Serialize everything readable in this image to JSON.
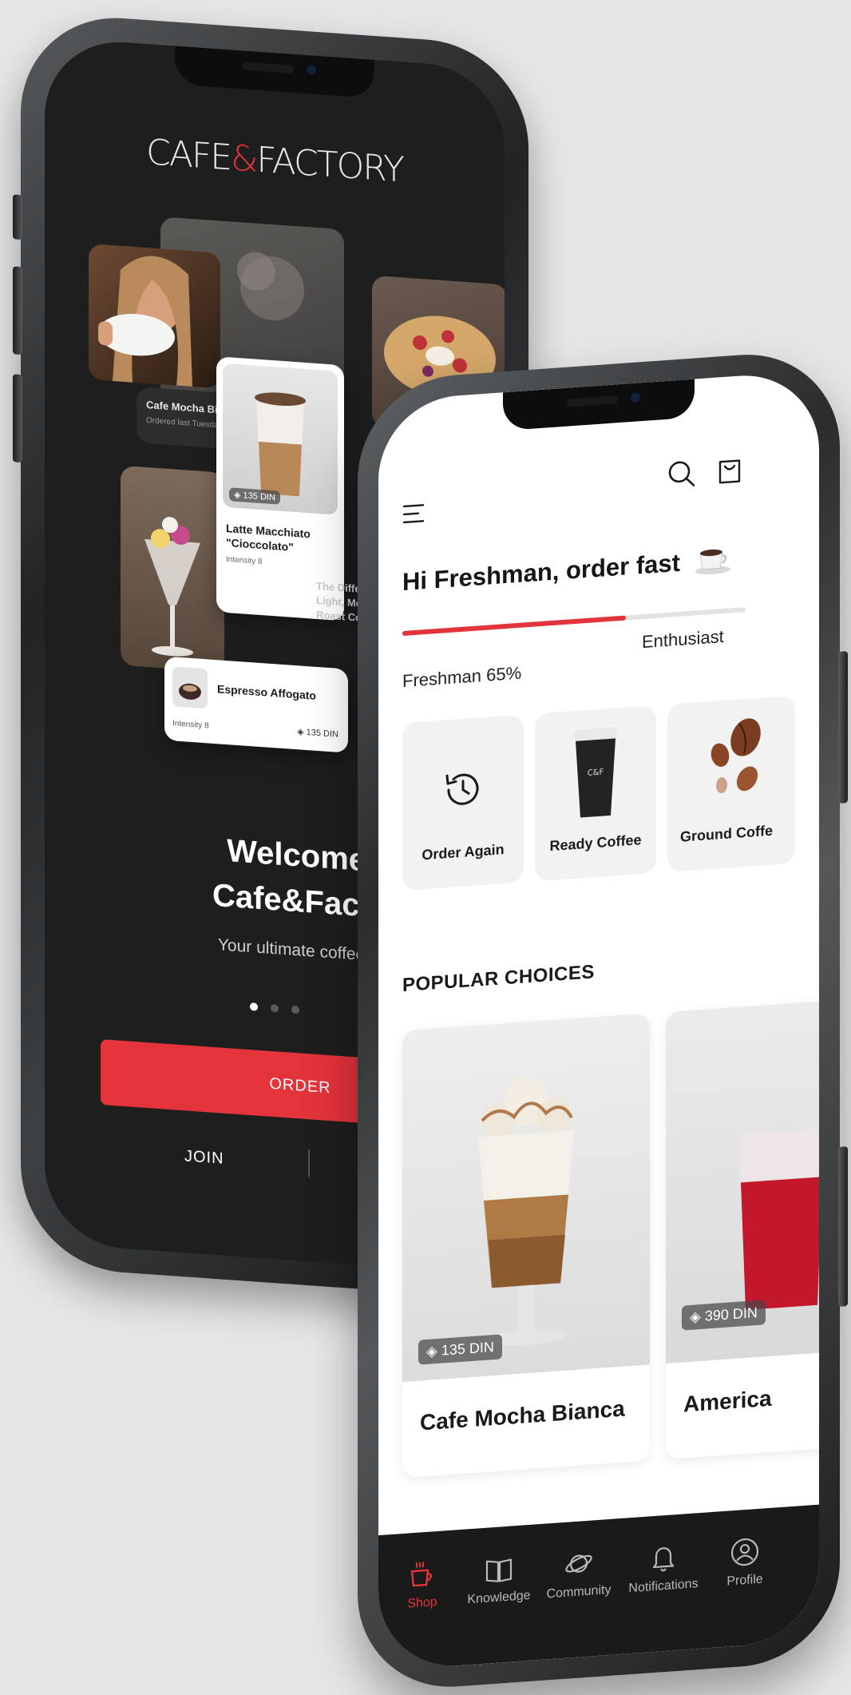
{
  "colors": {
    "accent": "#e3333b",
    "background": "#e6e6e6",
    "dark_screen": "#1e1e1e",
    "tab_bar": "#1a1a1a"
  },
  "onboarding_screen": {
    "logo": {
      "prefix": "CAFE",
      "amp": "&",
      "suffix": "FACTORY"
    },
    "carousel_cards": [
      {
        "title": "Cafe Mocha Bian",
        "subtitle": "Ordered last Tuesday"
      },
      {
        "price": "135 DIN",
        "title": "Latte Macchiato \"Cioccolato\"",
        "subtitle": "Intensity 8"
      },
      {
        "title": "The Difference B Light, Medium, A Roast Coffee"
      },
      {
        "title": "Espresso Affogato",
        "subtitle": "Intensity 8",
        "price": "135 DIN"
      }
    ],
    "welcome_line1": "Welcome to",
    "welcome_line2": "Cafe&Factory",
    "welcome_sub": "Your ultimate coffee destin",
    "page_indicator": {
      "current": 1,
      "total": 3
    },
    "order_button": "ORDER",
    "join_link": "JOIN"
  },
  "shop_screen": {
    "greeting": "Hi Freshman, order fast",
    "greeting_icon": "coffee-cup-icon",
    "progress": {
      "current_level": "Freshman 65%",
      "next_level": "Enthusiast",
      "value": 0.65
    },
    "quick_actions": [
      {
        "label": "Order Again",
        "icon": "history-icon"
      },
      {
        "label": "Ready Coffee",
        "icon": "takeaway-cup-image"
      },
      {
        "label": "Ground Coffe",
        "icon": "coffee-beans-image"
      }
    ],
    "section_title": "POPULAR CHOICES",
    "products": [
      {
        "name": "Cafe Mocha Bianca",
        "price": "135 DIN"
      },
      {
        "name": "America",
        "price": "390 DIN"
      }
    ],
    "tabs": [
      {
        "label": "Shop",
        "icon": "cup-icon",
        "active": true
      },
      {
        "label": "Knowledge",
        "icon": "book-icon",
        "active": false
      },
      {
        "label": "Community",
        "icon": "planet-icon",
        "active": false
      },
      {
        "label": "Notifications",
        "icon": "bell-icon",
        "active": false
      },
      {
        "label": "Profile",
        "icon": "user-icon",
        "active": false
      }
    ]
  }
}
